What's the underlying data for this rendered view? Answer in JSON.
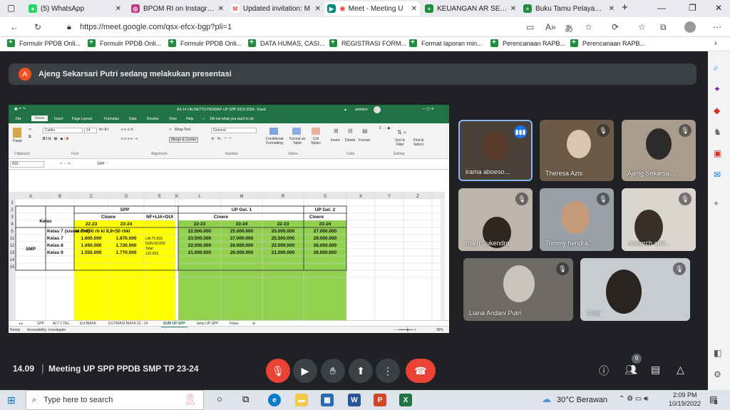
{
  "browser": {
    "tabs": [
      {
        "title": "(5) WhatsApp",
        "icon": "whatsapp-icon",
        "color": "#25d366"
      },
      {
        "title": "BPOM RI on Instagram",
        "icon": "instagram-icon",
        "color": "#c13584"
      },
      {
        "title": "Updated invitation: M",
        "icon": "gmail-icon",
        "color": "#ea4335"
      },
      {
        "title": "Meet - Meeting U",
        "icon": "meet-icon",
        "color": "#00897b"
      },
      {
        "title": "KEUANGAN AR SEKOL",
        "icon": "sheets-icon",
        "color": "#1e8e3e"
      },
      {
        "title": "Buku Tamu Pelayanan",
        "icon": "sheets-icon",
        "color": "#1e8e3e"
      }
    ],
    "url": "https://meet.google.com/qsx-efcx-bgp?pli=1",
    "bookmarks": [
      "Formulir PPDB Onli...",
      "Formulir PPDB Onli...",
      "Formulir PPDB Onli...",
      "DATA HUMAS, CASI...",
      "REGISTRASI FORM...",
      "Format laporan min...",
      "Perencanaan RAPB...",
      "Perencanaan RAPB..."
    ]
  },
  "meet": {
    "presenter_initial": "A",
    "presenter_banner": "Ajeng Sekarsari Putri sedang melakukan presentasi",
    "time": "14.09",
    "meeting_title": "Meeting UP SPP PPDB SMP TP 23-24",
    "participant_count": "9",
    "participants": [
      {
        "name": "irama aboeso...",
        "speaking": true
      },
      {
        "name": "Theresa Azis",
        "speaking": false
      },
      {
        "name": "Ajeng Sekarsa...",
        "speaking": false
      },
      {
        "name": "Imam Sukendro",
        "speaking": false
      },
      {
        "name": "Tommy hendra...",
        "speaking": false
      },
      {
        "name": "research and...",
        "speaking": false
      },
      {
        "name": "Liana Andani Putri",
        "speaking": false
      },
      {
        "name": "Anda",
        "speaking": false
      }
    ]
  },
  "excel": {
    "title": "AS 14 Okt NETTO PENDAP. UP SPP 2023-2024 - Excel",
    "user": "ambimo",
    "ribbon_tabs": [
      "File",
      "Home",
      "Insert",
      "Page Layout",
      "Formulas",
      "Data",
      "Review",
      "View",
      "Help"
    ],
    "tell_me": "Tell me what you want to do",
    "font_name": "Calibri",
    "font_size": "14",
    "number_format": "General",
    "wrap_text": "Wrap Text",
    "merge_center": "Merge & Center",
    "ribbon_groups": [
      "Clipboard",
      "Font",
      "Alignment",
      "Number",
      "Styles",
      "Cells",
      "Editing"
    ],
    "ribbon_buttons": [
      "Paste",
      "Conditional Formatting",
      "Format as Table",
      "Cell Styles",
      "Insert",
      "Delete",
      "Format",
      "Sort & Filter",
      "Find & Select"
    ],
    "name_box": "A31",
    "formula": "SMP",
    "columns": [
      "A",
      "B",
      "C",
      "D",
      "E",
      "K",
      "L",
      "M",
      "R",
      "S",
      "X",
      "Y",
      "Z"
    ],
    "rows": [
      "1",
      "2",
      "3",
      "4",
      "5",
      "11",
      "12",
      "13",
      "14",
      "15"
    ],
    "cells": {
      "kelas": "Kelas",
      "spp": "SPP",
      "up1": "UP Gel. 1",
      "up2": "UP Gel. 2",
      "cinere": "Cinere",
      "nf": "NF+LIA+DUI",
      "y2223": "22-23",
      "y2324": "23-24",
      "smp": "SMP",
      "k7siswa": "Kelas 7 (siswa dlm)",
      "k7": "Kelas 7",
      "k8": "Kelas 8",
      "k9": "Kelas 9",
      "note11": "kl 7+200 rb kl 8,9+50 rbkl",
      "c12": "1.600.000",
      "d12": "1.870.000",
      "e12": "LIA 70.833",
      "c13": "1.650.000",
      "d13": "1.720.000",
      "e13a": "DUN 50.000",
      "e13b": "Total",
      "c14": "1.550.000",
      "d14": "1.770.000",
      "e14": "120.833",
      "l11": "22.500.000",
      "m11": "25.000.000",
      "r11": "25.000.000",
      "s11": "27.000.000",
      "l12": "23.500.000",
      "m12": "27.000.000",
      "r12": "25.500.000",
      "s12": "29.000.000",
      "l13": "22.000.000",
      "m13": "26.000.000",
      "r13": "22.000.000",
      "s13": "26.000.000",
      "l14": "21.000.000",
      "m14": "26.000.000",
      "r14": "21.000.000",
      "s14": "26.000.000"
    },
    "sheets": [
      "SPP",
      "ALT 2 DEL",
      "Est BIAYA",
      "ESTIMASI BIAYA 23 - 24",
      "SUM UP SPP",
      "lamp UP SPP",
      "Kelas"
    ],
    "status_ready": "Ready",
    "status_accessibility": "Accessibility: Investigate",
    "zoom": "99%"
  },
  "taskbar": {
    "search_placeholder": "Type here to search",
    "weather": "30°C Berawan",
    "time": "2:09 PM",
    "date": "10/19/2022",
    "notification_count": "8"
  },
  "colors": {
    "yellow": "#ffff00",
    "green": "#92d050",
    "excel_green": "#217346",
    "end_call": "#ea4335"
  }
}
